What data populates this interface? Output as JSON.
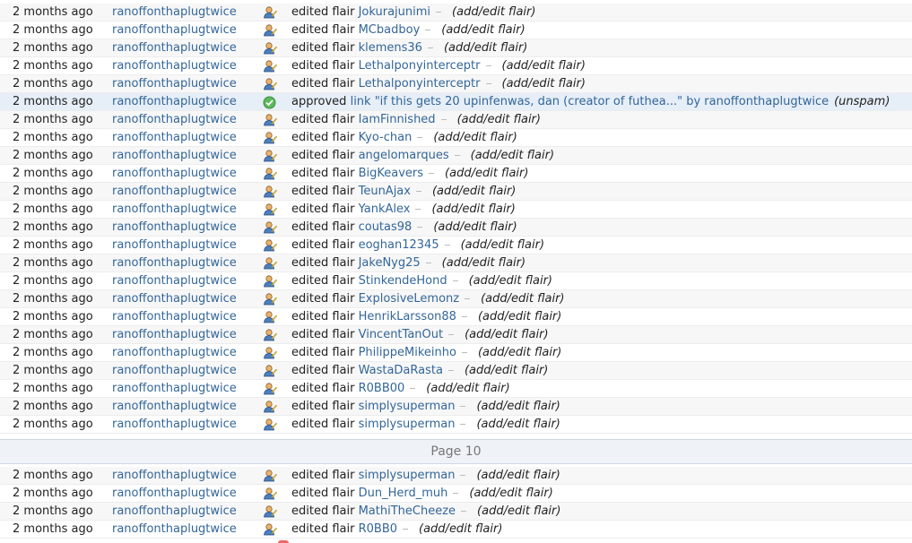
{
  "section1": [
    {
      "time": "2 months ago",
      "mod": "ranoffonthaplugtwice",
      "icon": "flair",
      "verb": "edited flair",
      "target": "Jokurajunimi",
      "desc": "(add/edit flair)"
    },
    {
      "time": "2 months ago",
      "mod": "ranoffonthaplugtwice",
      "icon": "flair",
      "verb": "edited flair",
      "target": "MCbadboy",
      "desc": "(add/edit flair)"
    },
    {
      "time": "2 months ago",
      "mod": "ranoffonthaplugtwice",
      "icon": "flair",
      "verb": "edited flair",
      "target": "klemens36",
      "desc": "(add/edit flair)"
    },
    {
      "time": "2 months ago",
      "mod": "ranoffonthaplugtwice",
      "icon": "flair",
      "verb": "edited flair",
      "target": "Lethalponyinterceptr",
      "desc": "(add/edit flair)"
    },
    {
      "time": "2 months ago",
      "mod": "ranoffonthaplugtwice",
      "icon": "flair",
      "verb": "edited flair",
      "target": "Lethalponyinterceptr",
      "desc": "(add/edit flair)"
    },
    {
      "time": "2 months ago",
      "mod": "ranoffonthaplugtwice",
      "icon": "approve",
      "verb": "approved",
      "target": "link \"if this gets 20 upinfenwas, dan (creator of futhea...\" by ranoffonthaplugtwice",
      "desc": "(unspam)",
      "highlight": true
    },
    {
      "time": "2 months ago",
      "mod": "ranoffonthaplugtwice",
      "icon": "flair",
      "verb": "edited flair",
      "target": "IamFinnished",
      "desc": "(add/edit flair)"
    },
    {
      "time": "2 months ago",
      "mod": "ranoffonthaplugtwice",
      "icon": "flair",
      "verb": "edited flair",
      "target": "Kyo-chan",
      "desc": "(add/edit flair)"
    },
    {
      "time": "2 months ago",
      "mod": "ranoffonthaplugtwice",
      "icon": "flair",
      "verb": "edited flair",
      "target": "angelomarques",
      "desc": "(add/edit flair)"
    },
    {
      "time": "2 months ago",
      "mod": "ranoffonthaplugtwice",
      "icon": "flair",
      "verb": "edited flair",
      "target": "BigKeavers",
      "desc": "(add/edit flair)"
    },
    {
      "time": "2 months ago",
      "mod": "ranoffonthaplugtwice",
      "icon": "flair",
      "verb": "edited flair",
      "target": "TeunAjax",
      "desc": "(add/edit flair)"
    },
    {
      "time": "2 months ago",
      "mod": "ranoffonthaplugtwice",
      "icon": "flair",
      "verb": "edited flair",
      "target": "YankAlex",
      "desc": "(add/edit flair)"
    },
    {
      "time": "2 months ago",
      "mod": "ranoffonthaplugtwice",
      "icon": "flair",
      "verb": "edited flair",
      "target": "coutas98",
      "desc": "(add/edit flair)"
    },
    {
      "time": "2 months ago",
      "mod": "ranoffonthaplugtwice",
      "icon": "flair",
      "verb": "edited flair",
      "target": "eoghan12345",
      "desc": "(add/edit flair)"
    },
    {
      "time": "2 months ago",
      "mod": "ranoffonthaplugtwice",
      "icon": "flair",
      "verb": "edited flair",
      "target": "JakeNyg25",
      "desc": "(add/edit flair)"
    },
    {
      "time": "2 months ago",
      "mod": "ranoffonthaplugtwice",
      "icon": "flair",
      "verb": "edited flair",
      "target": "StinkendeHond",
      "desc": "(add/edit flair)"
    },
    {
      "time": "2 months ago",
      "mod": "ranoffonthaplugtwice",
      "icon": "flair",
      "verb": "edited flair",
      "target": "ExplosiveLemonz",
      "desc": "(add/edit flair)"
    },
    {
      "time": "2 months ago",
      "mod": "ranoffonthaplugtwice",
      "icon": "flair",
      "verb": "edited flair",
      "target": "HenrikLarsson88",
      "desc": "(add/edit flair)"
    },
    {
      "time": "2 months ago",
      "mod": "ranoffonthaplugtwice",
      "icon": "flair",
      "verb": "edited flair",
      "target": "VincentTanOut",
      "desc": "(add/edit flair)"
    },
    {
      "time": "2 months ago",
      "mod": "ranoffonthaplugtwice",
      "icon": "flair",
      "verb": "edited flair",
      "target": "PhilippeMikeinho",
      "desc": "(add/edit flair)"
    },
    {
      "time": "2 months ago",
      "mod": "ranoffonthaplugtwice",
      "icon": "flair",
      "verb": "edited flair",
      "target": "WastaDaRasta",
      "desc": "(add/edit flair)"
    },
    {
      "time": "2 months ago",
      "mod": "ranoffonthaplugtwice",
      "icon": "flair",
      "verb": "edited flair",
      "target": "R0BB00",
      "desc": "(add/edit flair)"
    },
    {
      "time": "2 months ago",
      "mod": "ranoffonthaplugtwice",
      "icon": "flair",
      "verb": "edited flair",
      "target": "simplysuperman",
      "desc": "(add/edit flair)"
    },
    {
      "time": "2 months ago",
      "mod": "ranoffonthaplugtwice",
      "icon": "flair",
      "verb": "edited flair",
      "target": "simplysuperman",
      "desc": "(add/edit flair)"
    }
  ],
  "page_label": "Page 10",
  "section2": [
    {
      "time": "2 months ago",
      "mod": "ranoffonthaplugtwice",
      "icon": "flair",
      "verb": "edited flair",
      "target": "simplysuperman",
      "desc": "(add/edit flair)"
    },
    {
      "time": "2 months ago",
      "mod": "ranoffonthaplugtwice",
      "icon": "flair",
      "verb": "edited flair",
      "target": "Dun_Herd_muh",
      "desc": "(add/edit flair)"
    },
    {
      "time": "2 months ago",
      "mod": "ranoffonthaplugtwice",
      "icon": "flair",
      "verb": "edited flair",
      "target": "MathiTheCheeze",
      "desc": "(add/edit flair)"
    },
    {
      "time": "2 months ago",
      "mod": "ranoffonthaplugtwice",
      "icon": "flair",
      "verb": "edited flair",
      "target": "R0BB0",
      "desc": "(add/edit flair)"
    }
  ],
  "colors": {
    "link": "#336699",
    "approve": "#4caf50",
    "highlight": "#e6eef7"
  }
}
